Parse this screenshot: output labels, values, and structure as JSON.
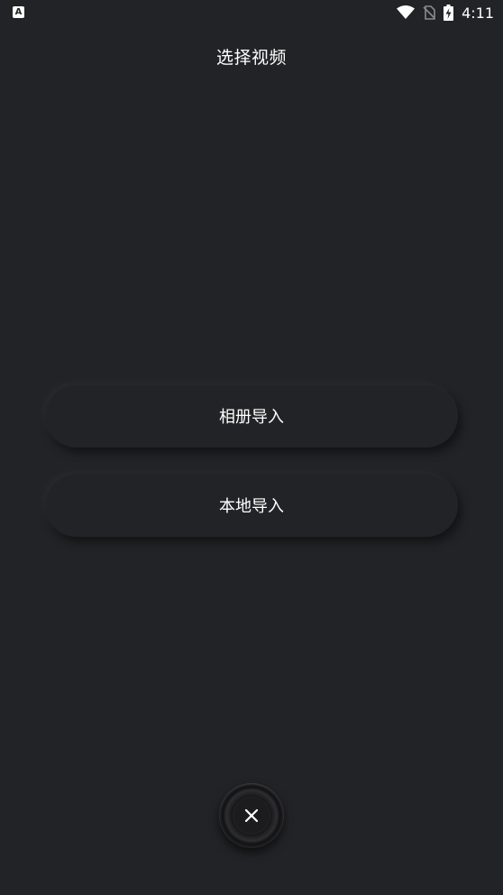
{
  "status_bar": {
    "notification_icon": "A",
    "time": "4:11",
    "icons": [
      "wifi-icon",
      "no-sim-icon",
      "battery-charging-icon"
    ]
  },
  "header": {
    "title": "选择视频"
  },
  "actions": {
    "album_import_label": "相册导入",
    "local_import_label": "本地导入"
  },
  "close_button": {
    "icon": "close-icon"
  },
  "colors": {
    "background": "#222326",
    "text": "#ffffff"
  }
}
